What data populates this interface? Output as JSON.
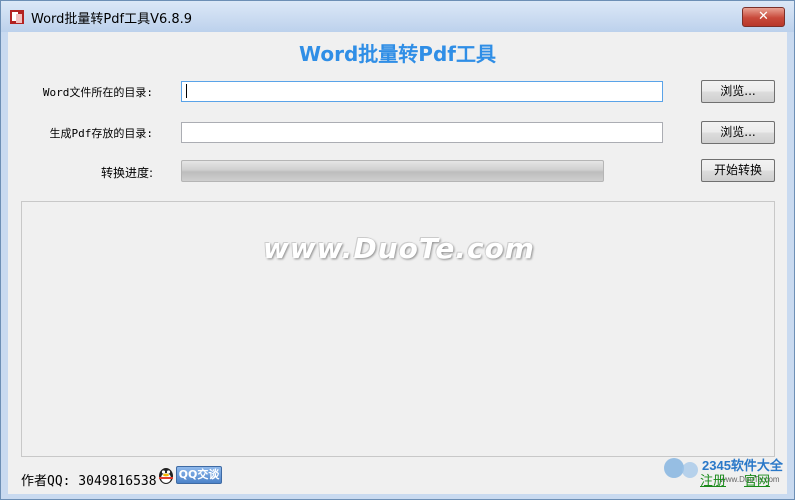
{
  "window": {
    "title": "Word批量转Pdf工具V6.8.9",
    "close_label": "✕"
  },
  "app": {
    "title": "Word批量转Pdf工具"
  },
  "form": {
    "word_dir_label": "Word文件所在的目录:",
    "word_dir_value": "",
    "pdf_dir_label": "生成Pdf存放的目录:",
    "pdf_dir_value": "",
    "progress_label": "转换进度:",
    "progress_value": 0,
    "browse_label": "浏览...",
    "start_label": "开始转换"
  },
  "log": {
    "watermark": "www.DuoTe.com"
  },
  "footer": {
    "author_label": "作者QQ: 3049816538",
    "qq_button": "QQ交谈",
    "register_link": "注册",
    "site_link": "官网"
  },
  "corner_badge": {
    "brand": "2345软件大全",
    "url": "www.DuoTe.com"
  },
  "colors": {
    "accent": "#2f8ee6",
    "link": "#1a8a1a",
    "close": "#c8493a"
  }
}
